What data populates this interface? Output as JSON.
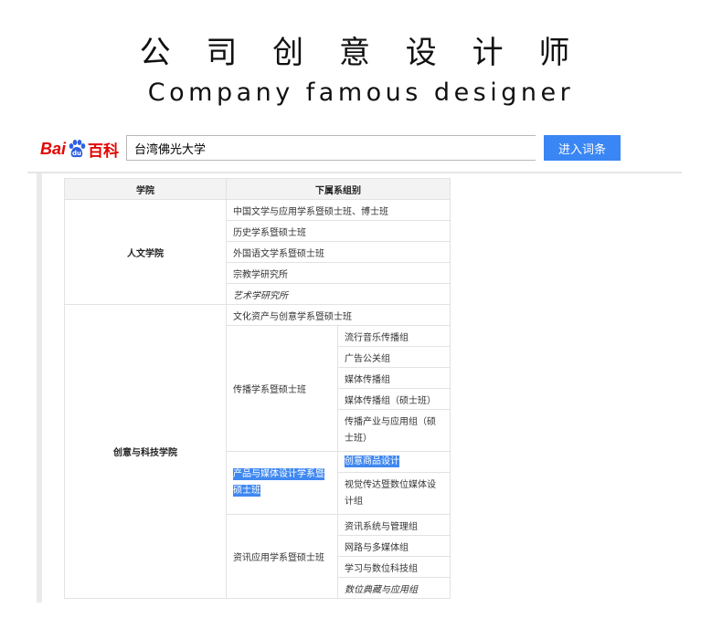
{
  "page": {
    "title": "公 司 创 意 设 计 师",
    "subtitle": "Company famous designer"
  },
  "header": {
    "logo_text_bai": "Bai",
    "logo_text_baike": "百科",
    "search_value": "台湾佛光大学",
    "search_button_label": "进入词条"
  },
  "table": {
    "headers": [
      "学院",
      "下属系组别"
    ],
    "humanities": {
      "college": "人文学院",
      "departments": [
        "中国文学与应用学系暨硕士班、博士班",
        "历史学系暨硕士班",
        "外国语文学系暨硕士班",
        "宗教学研究所",
        "艺术学研究所"
      ]
    },
    "creative": {
      "college": "创意与科技学院",
      "cultural": "文化资产与创意学系暨硕士班",
      "communication": {
        "name": "传播学系暨硕士班",
        "groups": [
          "流行音乐传播组",
          "广告公关组",
          "媒体传播组",
          "媒体传播组（硕士班）",
          "传播产业与应用组（硕士班）"
        ]
      },
      "product": {
        "name": "产品与媒体设计学系暨硕士班",
        "groups": [
          "创意商品设计",
          "视觉传达暨数位媒体设计组"
        ]
      },
      "info": {
        "name": "资讯应用学系暨硕士班",
        "groups": [
          "资讯系统与管理组",
          "网路与多媒体组",
          "学习与数位科技组",
          "数位典藏与应用组"
        ]
      }
    }
  },
  "colors": {
    "accent": "#3a86f4",
    "brand_red": "#e10601",
    "selection": "#3f88f1"
  }
}
